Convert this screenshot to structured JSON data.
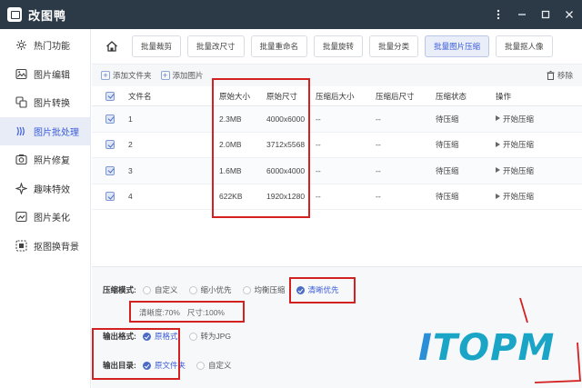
{
  "app": {
    "title": "改图鸭",
    "accent": "#3b5bdb",
    "titlebar_bg": "#2c3a47"
  },
  "window_controls": [
    {
      "name": "more-icon"
    },
    {
      "name": "minimize-icon"
    },
    {
      "name": "maximize-icon"
    },
    {
      "name": "close-icon"
    }
  ],
  "sidebar": {
    "items": [
      {
        "label": "热门功能",
        "icon": "hot-icon"
      },
      {
        "label": "图片编辑",
        "icon": "image-edit-icon"
      },
      {
        "label": "图片转换",
        "icon": "image-convert-icon"
      },
      {
        "label": "图片批处理",
        "icon": "batch-process-icon"
      },
      {
        "label": "照片修复",
        "icon": "photo-repair-icon"
      },
      {
        "label": "趣味特效",
        "icon": "fun-effect-icon"
      },
      {
        "label": "图片美化",
        "icon": "beautify-icon"
      },
      {
        "label": "抠图换背景",
        "icon": "cutout-icon"
      }
    ],
    "active_index": 3
  },
  "toolbar": {
    "home_icon": "home-icon",
    "buttons": [
      {
        "label": "批量裁剪"
      },
      {
        "label": "批量改尺寸"
      },
      {
        "label": "批量重命名"
      },
      {
        "label": "批量旋转"
      },
      {
        "label": "批量分类"
      },
      {
        "label": "批量图片压缩"
      },
      {
        "label": "批量抠人像"
      }
    ],
    "active_index": 5
  },
  "actions": {
    "add_file": "添加文件夹",
    "add_image": "添加图片",
    "remove": "移除"
  },
  "table": {
    "columns": [
      "文件名",
      "原始大小",
      "原始尺寸",
      "压缩后大小",
      "压缩后尺寸",
      "压缩状态",
      "操作"
    ],
    "rows": [
      {
        "name": "1",
        "osize": "2.3MB",
        "odim": "4000x6000",
        "csize": "--",
        "cdim": "--",
        "status": "待压缩",
        "op": "开始压缩"
      },
      {
        "name": "2",
        "osize": "2.0MB",
        "odim": "3712x5568",
        "csize": "--",
        "cdim": "--",
        "status": "待压缩",
        "op": "开始压缩"
      },
      {
        "name": "3",
        "osize": "1.6MB",
        "odim": "6000x4000",
        "csize": "--",
        "cdim": "--",
        "status": "待压缩",
        "op": "开始压缩"
      },
      {
        "name": "4",
        "osize": "622KB",
        "odim": "1920x1280",
        "csize": "--",
        "cdim": "--",
        "status": "待压缩",
        "op": "开始压缩"
      }
    ]
  },
  "settings": {
    "mode_label": "压缩模式:",
    "mode_options": [
      "自定义",
      "缩小优先",
      "均衡压缩",
      "清晰优先"
    ],
    "mode_selected": 3,
    "clarity": "清晰度:70%",
    "size": "尺寸:100%",
    "format_label": "输出格式:",
    "format_options": [
      "原格式",
      "转为JPG"
    ],
    "format_selected": 0,
    "dir_label": "输出目录:",
    "dir_options": [
      "原文件夹",
      "自定义"
    ],
    "dir_selected": 0
  },
  "watermark": {
    "text_i": "I",
    "text_rest": "TOPM"
  },
  "highlight_color": "#d32020"
}
